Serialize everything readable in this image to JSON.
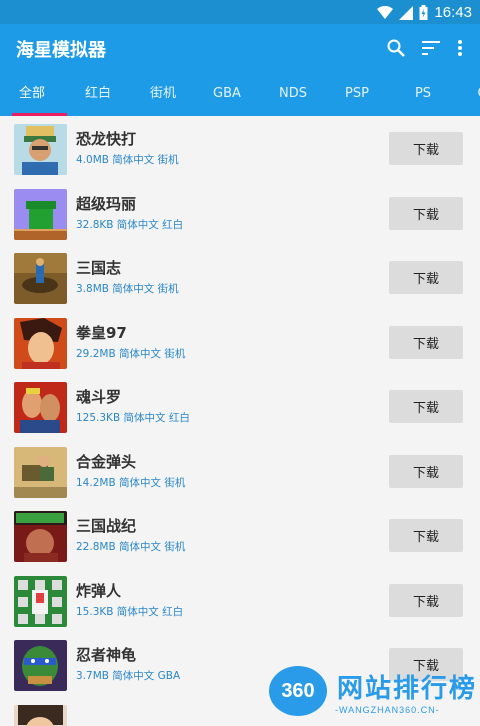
{
  "status_bar": {
    "time": "16:43",
    "icons": [
      "wifi-icon",
      "signal-icon",
      "battery-icon"
    ]
  },
  "app_bar": {
    "title": "海星模拟器",
    "actions": [
      "search-icon",
      "sort-icon",
      "more-vert-icon"
    ]
  },
  "tabs": [
    "全部",
    "红白",
    "街机",
    "GBA",
    "NDS",
    "PSP",
    "PS",
    "C"
  ],
  "active_tab": "全部",
  "games": [
    {
      "name": "恐龙快打",
      "meta": "4.0MB 简体中文 街机",
      "button": "下载"
    },
    {
      "name": "超级玛丽",
      "meta": "32.8KB 简体中文 红白",
      "button": "下载"
    },
    {
      "name": "三国志",
      "meta": "3.8MB 简体中文 街机",
      "button": "下载"
    },
    {
      "name": "拳皇97",
      "meta": "29.2MB 简体中文 街机",
      "button": "下载"
    },
    {
      "name": "魂斗罗",
      "meta": "125.3KB 简体中文 红白",
      "button": "下载"
    },
    {
      "name": "合金弹头",
      "meta": "14.2MB 简体中文 街机",
      "button": "下载"
    },
    {
      "name": "三国战纪",
      "meta": "22.8MB 简体中文 街机",
      "button": "下载"
    },
    {
      "name": "炸弹人",
      "meta": "15.3KB 简体中文 红白",
      "button": "下载"
    },
    {
      "name": "忍者神龟",
      "meta": "3.7MB 简体中文 GBA",
      "button": "下载"
    },
    {
      "name": "",
      "meta": "",
      "button": ""
    }
  ],
  "watermark": {
    "badge": "360",
    "text": "网站排行榜",
    "url": "-WANGZHAN360.CN-"
  },
  "colors": {
    "primary": "#1e9be6",
    "status_bar": "#1c8fd1",
    "indicator": "#e91e63",
    "meta_text": "#2a87c9",
    "button_bg": "#dcdcdc"
  }
}
